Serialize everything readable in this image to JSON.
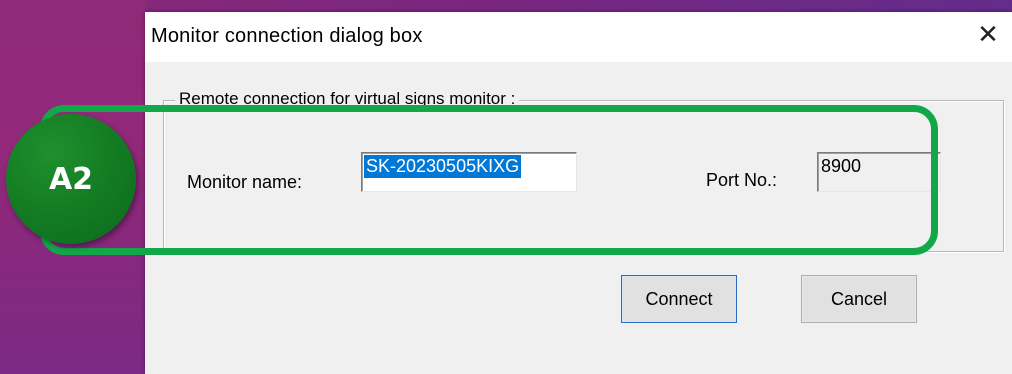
{
  "dialog": {
    "title": "Monitor connection dialog box",
    "close_icon": "close-icon"
  },
  "group": {
    "legend": "Remote connection for virtual signs monitor :"
  },
  "monitor": {
    "label": "Monitor name:",
    "value": "SK-20230505KIXG"
  },
  "port": {
    "label": "Port No.:",
    "value": "8900"
  },
  "buttons": {
    "connect": "Connect",
    "cancel": "Cancel"
  },
  "annotation": {
    "badge": "A2",
    "highlight_color": "#12a84a",
    "badge_color": "#127a22"
  },
  "colors": {
    "selection": "#0078d7",
    "dialog_bg": "#f0f0f0"
  }
}
